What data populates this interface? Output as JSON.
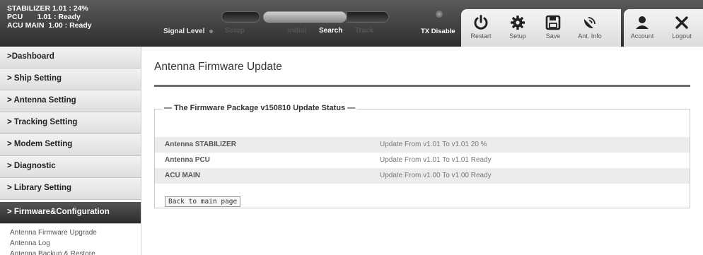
{
  "header": {
    "status_lines": [
      "STABILIZER 1.01 : 24%",
      "PCU       1.01 : Ready",
      "ACU MAIN  1.00 : Ready"
    ],
    "signal_label": "Signal Level",
    "modes": {
      "setup": "Setup",
      "initial": "Initial",
      "search": "Search",
      "track": "Track"
    },
    "tx_label": "TX Disable",
    "tools": {
      "restart": "Restart",
      "setup": "Setup",
      "save": "Save",
      "ant_info": "Ant. Info"
    },
    "account": {
      "account": "Account",
      "logout": "Logout"
    }
  },
  "sidebar": {
    "items": [
      ">Dashboard",
      "> Ship Setting",
      "> Antenna Setting",
      "> Tracking Setting",
      "> Modem Setting",
      "> Diagnostic",
      "> Library Setting"
    ],
    "active_item": "> Firmware&Configuration",
    "sub_items": [
      "Antenna Firmware Upgrade",
      "Antenna Log",
      "Antenna Backup & Restore"
    ]
  },
  "main": {
    "title": "Antenna Firmware Update",
    "legend": "The Firmware Package v150810 Update Status",
    "rows": [
      {
        "name": "Antenna STABILIZER",
        "status": "Update From v1.01 To v1.01 20 %"
      },
      {
        "name": "Antenna PCU",
        "status": "Update From v1.01 To v1.01 Ready"
      },
      {
        "name": "ACU MAIN",
        "status": "Update From v1.00 To v1.00 Ready"
      }
    ],
    "back_button": "Back to main page"
  },
  "colors": {
    "header_dark": "#2e2e2e",
    "active_nav": "#2b2b2b",
    "rule": "#6d6d6d"
  },
  "icons": [
    "power-icon",
    "gear-icon",
    "floppy-icon",
    "satellite-icon",
    "user-icon",
    "close-icon"
  ]
}
